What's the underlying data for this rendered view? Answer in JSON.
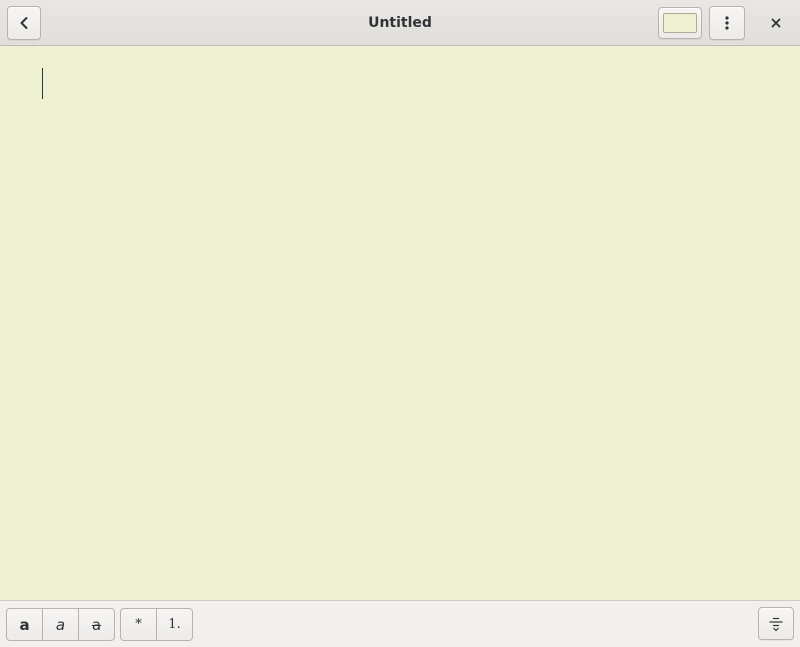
{
  "window": {
    "title": "Untitled",
    "note_color": "#edf1d1"
  },
  "headerbar": {
    "back_icon": "go-previous-icon",
    "color_button_icon": "color-swatch",
    "menu_icon": "view-more-icon",
    "close_icon": "window-close-icon"
  },
  "editor": {
    "content": ""
  },
  "toolbar": {
    "format_buttons": [
      {
        "label": "a",
        "icon": "format-text-bold-icon"
      },
      {
        "label": "a",
        "icon": "format-text-italic-icon"
      },
      {
        "label": "a",
        "icon": "format-text-strikethrough-icon"
      }
    ],
    "list_buttons": [
      {
        "label": "*",
        "icon": "bullet-list"
      },
      {
        "label": "1.",
        "icon": "numbered-list"
      }
    ],
    "text_alignment_icon": "text-alignment-icon"
  }
}
